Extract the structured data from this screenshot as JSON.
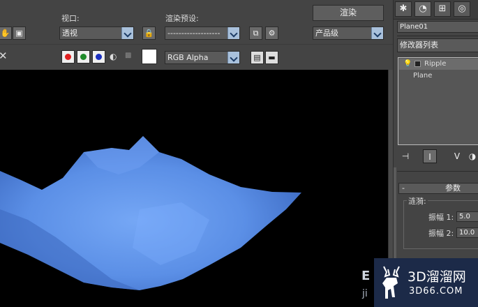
{
  "toolbar": {
    "viewport_label": "视口:",
    "viewport_value": "透视",
    "preset_label": "渲染预设:",
    "preset_value": "-------------------",
    "render_button": "渲染",
    "quality_value": "产品级",
    "channel_value": "RGB Alpha",
    "close_glyph": "✕"
  },
  "command_panel": {
    "object_name": "Plane01",
    "modifier_list_label": "修改器列表",
    "stack": [
      {
        "label": "Ripple",
        "selected": true
      },
      {
        "label": "Plane",
        "selected": false
      }
    ],
    "rollout_title": "参数",
    "rollout_toggle": "-",
    "group_title": "涟漪:",
    "params": [
      {
        "label": "振幅 1:",
        "value": "5.0"
      },
      {
        "label": "振幅 2:",
        "value": "10.0"
      }
    ]
  },
  "watermark": {
    "brand": "3D溜溜网",
    "domain": "3D66.COM",
    "left_fragment": "E",
    "left_fragment2": "ji"
  },
  "colors": {
    "surface": "#5b8fe6",
    "viewport_bg": "#000000",
    "panel_bg": "#444444",
    "red_channel": "#e02020",
    "green_channel": "#1f8a2a",
    "blue_channel": "#1b2fbf"
  }
}
